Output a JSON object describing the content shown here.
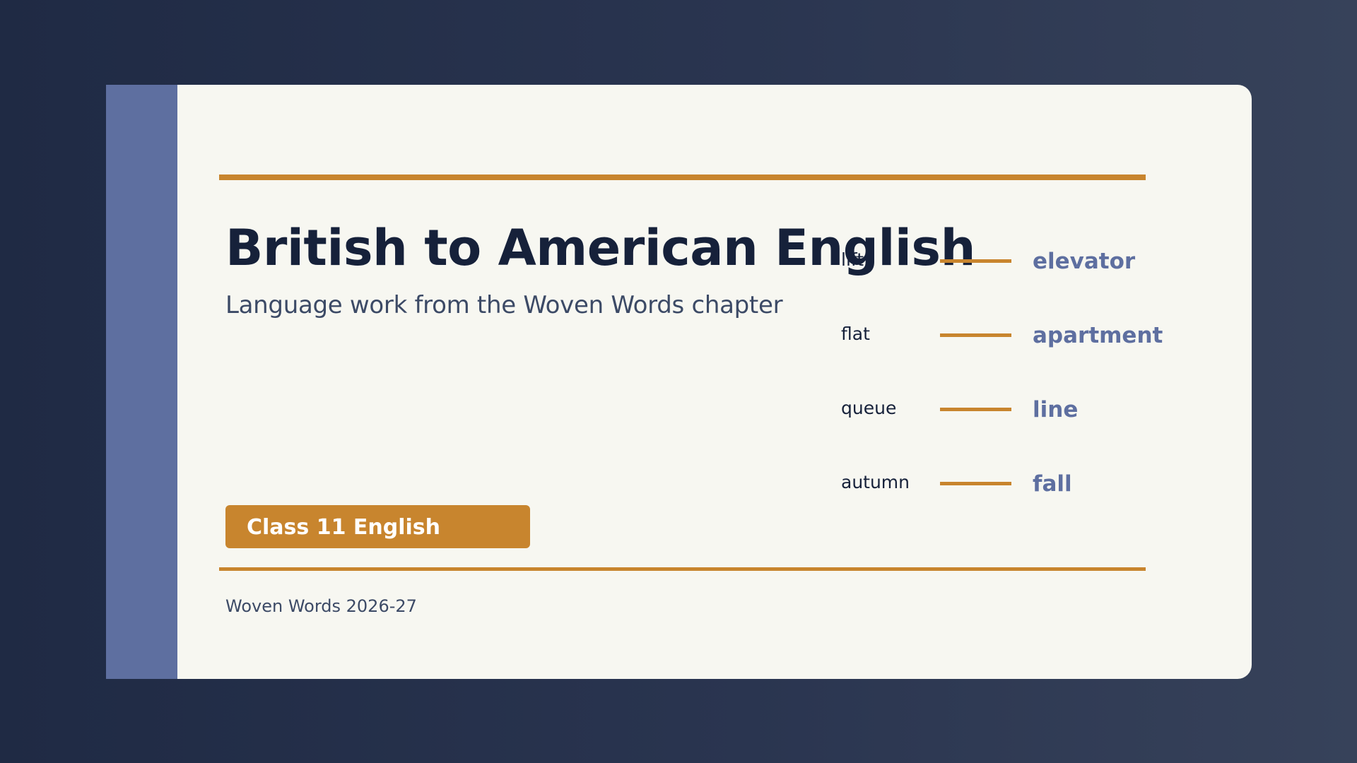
{
  "slide": {
    "title": "British to American English",
    "subtitle": "Language work from the Woven Words chapter",
    "badge_label": "Class 11 English",
    "footer": "Woven Words 2026-27"
  },
  "word_pairs": [
    {
      "british": "lift",
      "american": "elevator"
    },
    {
      "british": "flat",
      "american": "apartment"
    },
    {
      "british": "queue",
      "american": "line"
    },
    {
      "british": "autumn",
      "american": "fall"
    }
  ],
  "colors": {
    "background": "#1f2a44",
    "card": "#f7f7f1",
    "spine": "#5e6fa0",
    "accent": "#c8852e",
    "title": "#16213a",
    "american_word": "#5e6fa0"
  }
}
